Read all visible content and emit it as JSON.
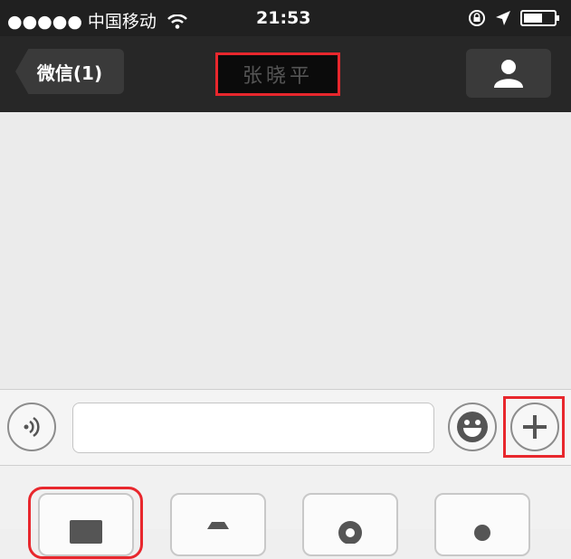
{
  "status_bar": {
    "carrier": "●●●●● 中国移动",
    "time": "21:53"
  },
  "navbar": {
    "back_label": "微信(1)",
    "title": "张晓平"
  },
  "colors": {
    "highlight": "#e8272d",
    "navbar": "#272727",
    "status_bar": "#202020"
  },
  "icons": [
    "wifi-icon",
    "lock-rotation-icon",
    "location-arrow-icon",
    "battery-icon",
    "person-icon",
    "voice-icon",
    "emoji-icon",
    "plus-icon",
    "image-icon",
    "camera-icon",
    "location-icon",
    "contact-card-icon"
  ]
}
